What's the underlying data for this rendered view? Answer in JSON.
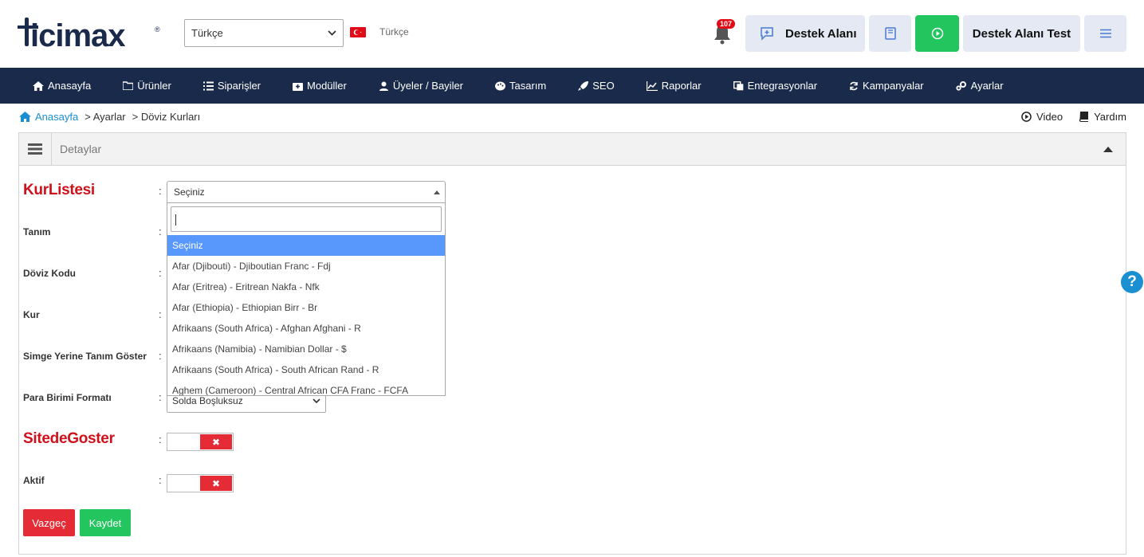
{
  "header": {
    "logo_text": "ticimax",
    "language_select_value": "Türkçe",
    "language_label": "Türkçe",
    "notification_count": "107",
    "support_button_label": "Destek Alanı",
    "user_button_label": "Destek Alanı Test"
  },
  "nav": {
    "items": [
      {
        "label": "Anasayfa",
        "icon": "home-icon"
      },
      {
        "label": "Ürünler",
        "icon": "folder-icon"
      },
      {
        "label": "Siparişler",
        "icon": "list-icon"
      },
      {
        "label": "Modüller",
        "icon": "box-icon"
      },
      {
        "label": "Üyeler / Bayiler",
        "icon": "users-icon"
      },
      {
        "label": "Tasarım",
        "icon": "palette-icon"
      },
      {
        "label": "SEO",
        "icon": "rocket-icon"
      },
      {
        "label": "Raporlar",
        "icon": "chart-icon"
      },
      {
        "label": "Entegrasyonlar",
        "icon": "copy-icon"
      },
      {
        "label": "Kampanyalar",
        "icon": "refresh-icon"
      },
      {
        "label": "Ayarlar",
        "icon": "gears-icon"
      }
    ]
  },
  "breadcrumb": {
    "home": "Anasayfa",
    "items": [
      "> Ayarlar",
      "> Döviz Kurları"
    ]
  },
  "top_links": {
    "video": "Video",
    "help": "Yardım"
  },
  "panel": {
    "title": "Detaylar"
  },
  "form": {
    "kurlistesi_label": "KurListesi",
    "kurlistesi_value": "Seçiniz",
    "tanim_label": "Tanım",
    "doviz_kodu_label": "Döviz Kodu",
    "kur_label": "Kur",
    "simge_label": "Simge Yerine Tanım Göster",
    "para_birimi_label": "Para Birimi Formatı",
    "para_birimi_value": "Solda Boşluksuz",
    "sitedegoster_label": "SitedeGoster",
    "aktif_label": "Aktif",
    "colon": ":",
    "toggle_off_symbol": "✖",
    "cancel_label": "Vazgeç",
    "save_label": "Kaydet"
  },
  "dropdown": {
    "options": [
      "Seçiniz",
      "Afar (Djibouti) - Djiboutian Franc - Fdj",
      "Afar (Eritrea) - Eritrean Nakfa - Nfk",
      "Afar (Ethiopia) - Ethiopian Birr - Br",
      "Afrikaans (South Africa) - Afghan Afghani - R",
      "Afrikaans (Namibia) - Namibian Dollar - $",
      "Afrikaans (South Africa) - South African Rand - R",
      "Aghem (Cameroon) - Central African CFA Franc - FCFA"
    ]
  },
  "help_button": "?"
}
